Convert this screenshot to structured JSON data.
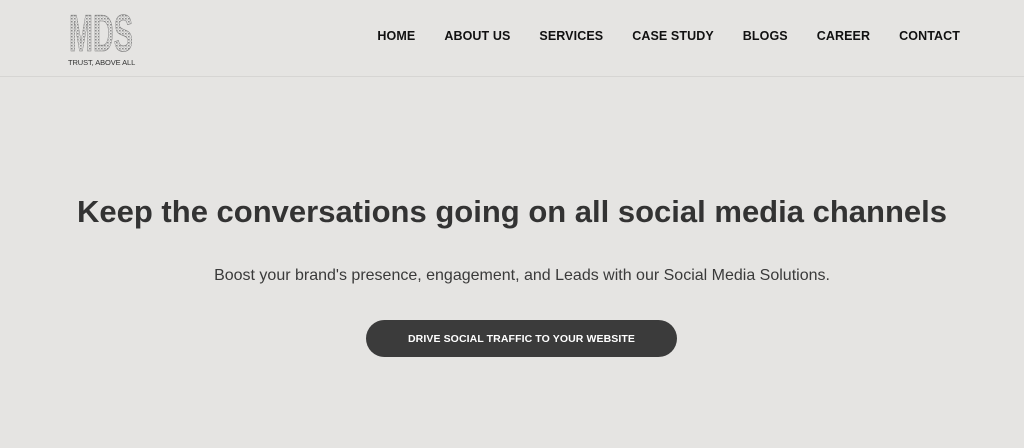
{
  "brand": {
    "logo_text": "MDS",
    "tagline": "TRUST, ABOVE ALL"
  },
  "nav": {
    "items": [
      {
        "label": "HOME"
      },
      {
        "label": "ABOUT US"
      },
      {
        "label": "SERVICES"
      },
      {
        "label": "CASE STUDY"
      },
      {
        "label": "BLOGS"
      },
      {
        "label": "CAREER"
      },
      {
        "label": "CONTACT"
      }
    ]
  },
  "hero": {
    "title": "Keep the conversations going on all social media channels",
    "subtitle": "Boost your brand's presence, engagement, and Leads with our Social Media Solutions.",
    "cta_label": "DRIVE SOCIAL TRAFFIC TO YOUR WEBSITE"
  },
  "colors": {
    "background": "#e5e4e2",
    "text": "#333333",
    "button": "#3b3b3b",
    "button_text": "#ffffff"
  }
}
